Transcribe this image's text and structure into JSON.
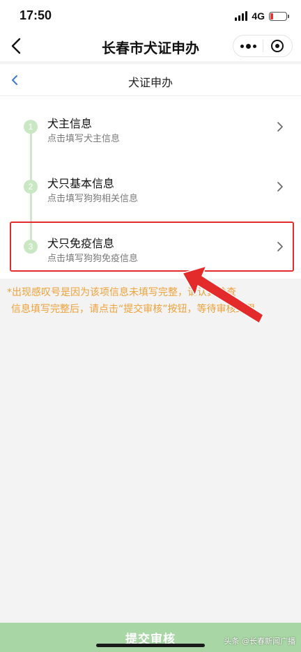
{
  "status_bar": {
    "time": "17:50",
    "network": "4G"
  },
  "app": {
    "title": "长春市犬证申办"
  },
  "page": {
    "title": "犬证申办"
  },
  "steps": [
    {
      "number": "1",
      "title": "犬主信息",
      "desc": "点击填写犬主信息"
    },
    {
      "number": "2",
      "title": "犬只基本信息",
      "desc": "点击填写狗狗相关信息"
    },
    {
      "number": "3",
      "title": "犬只免疫信息",
      "desc": "点击填写狗狗免疫信息"
    }
  ],
  "notice": {
    "line1": "*出现感叹号是因为该项信息未填写完整，请认真检查",
    "line2": "信息填写完整后，请点击“提交审核”按钮，等待审核结果"
  },
  "submit": {
    "label": "提交审核"
  },
  "watermark": "头条 @长春新闻广播",
  "colors": {
    "accent_green": "#a8d6a4",
    "step_circle": "#c9e7c3",
    "notice_text": "#eda23a",
    "highlight_red": "#e32b2b",
    "link_blue": "#3a78d8"
  }
}
